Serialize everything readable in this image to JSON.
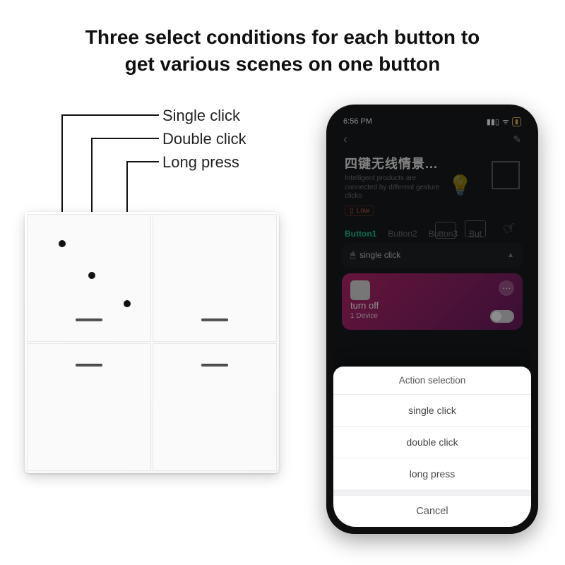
{
  "headline": {
    "line1": "Three select conditions for each button to",
    "line2": "get various scenes on one button"
  },
  "callouts": {
    "single": "Single click",
    "double": "Double click",
    "long": "Long press"
  },
  "phone": {
    "status_time": "6:56 PM",
    "device_title": "四键无线情景...",
    "device_sub": "Intelligent products are connected by different gesture clicks",
    "low_label": "Low",
    "tabs": {
      "t1": "Button1",
      "t2": "Button2",
      "t3": "Button3",
      "t4": "But"
    },
    "row_label": "single click",
    "scene_name": "turn off",
    "scene_sub": "1 Device",
    "sheet": {
      "title": "Action selection",
      "o1": "single click",
      "o2": "double click",
      "o3": "long press",
      "cancel": "Cancel"
    }
  }
}
